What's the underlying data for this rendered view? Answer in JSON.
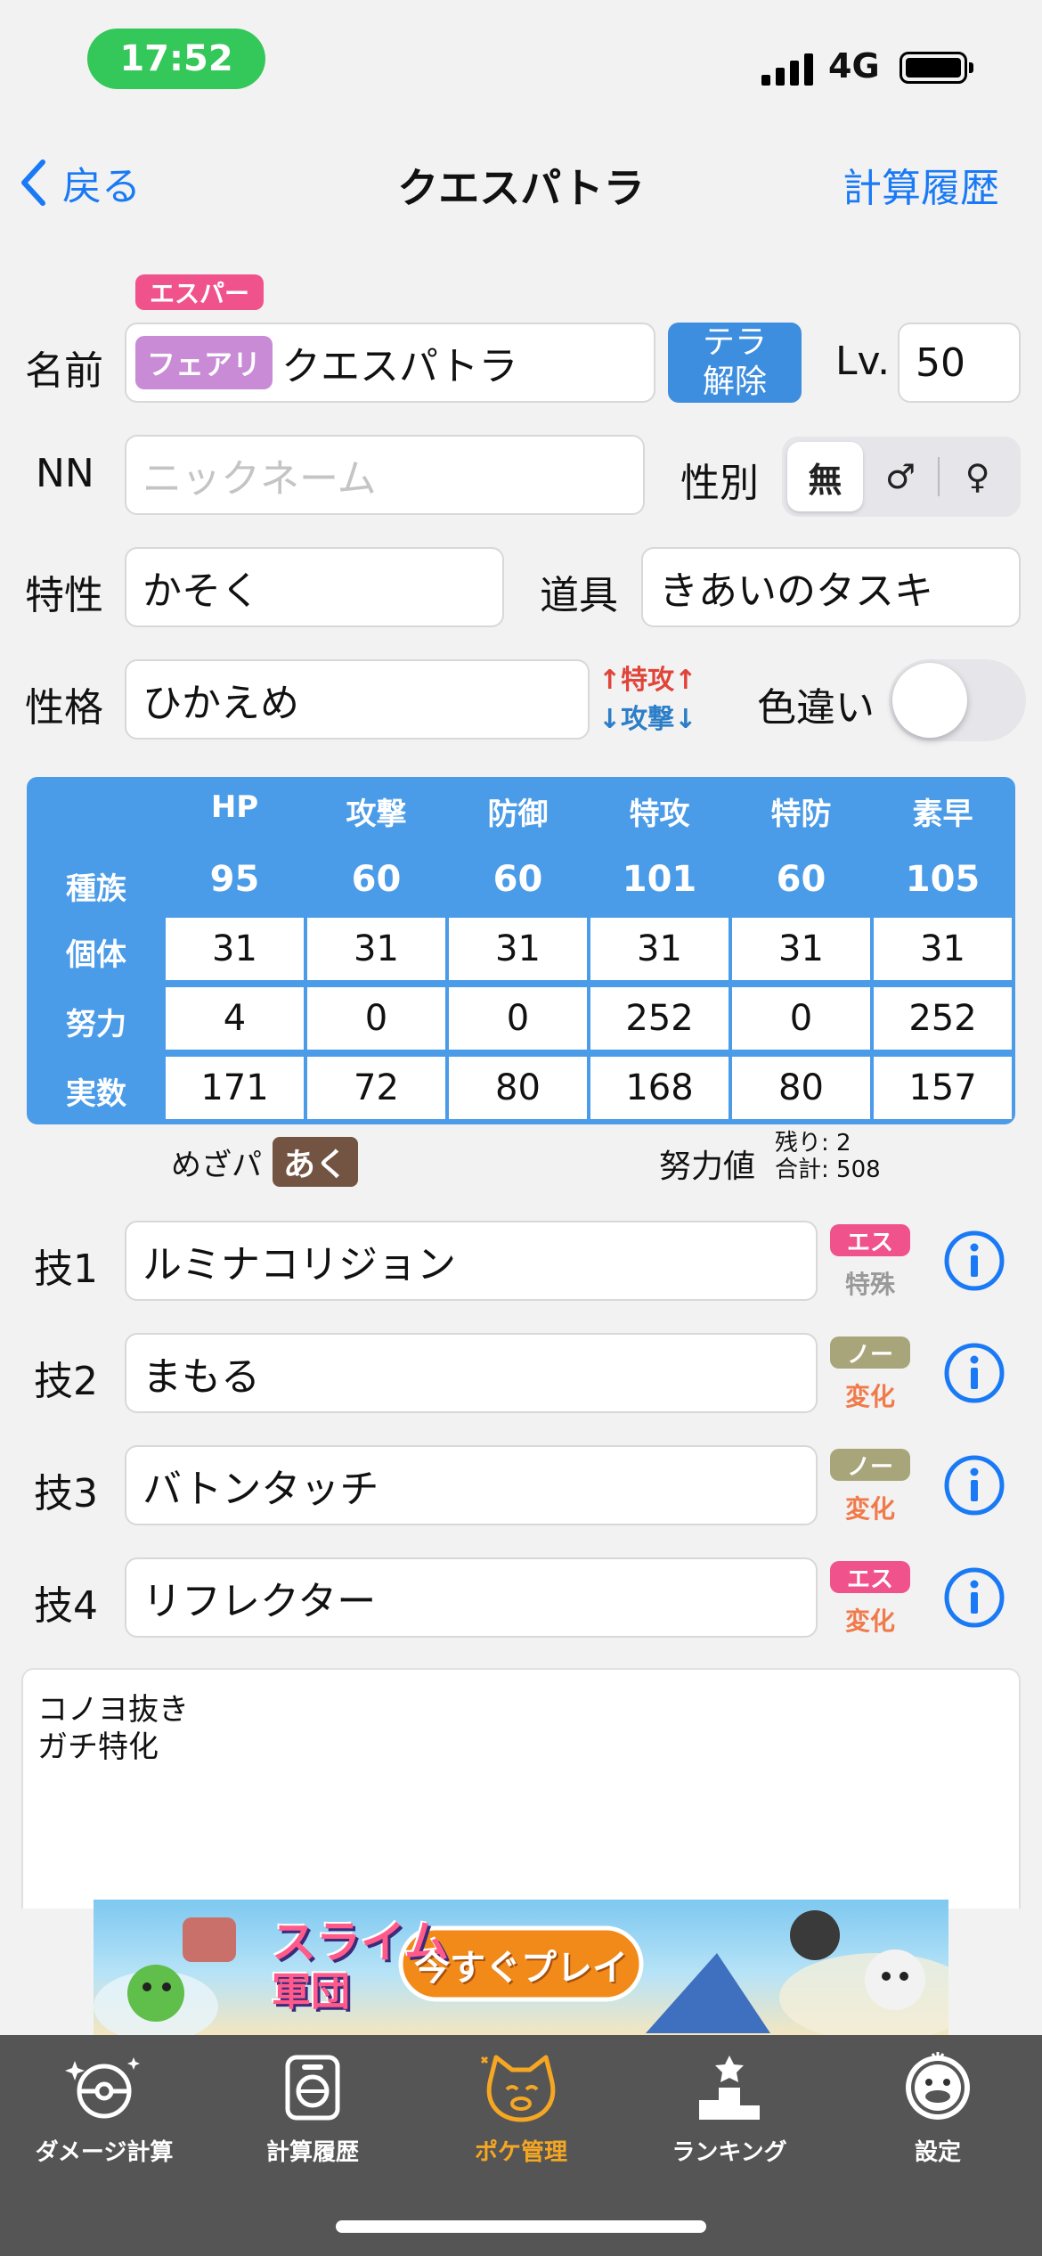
{
  "status_bar": {
    "time": "17:52",
    "network": "4G"
  },
  "nav": {
    "back_label": "戻る",
    "title": "クエスパトラ",
    "history_label": "計算履歴"
  },
  "form": {
    "type1": "エスパー",
    "type2": "フェアリ",
    "name_label": "名前",
    "name_value": "クエスパトラ",
    "tera_line1": "テラ",
    "tera_line2": "解除",
    "level_label": "Lv.",
    "level_value": "50",
    "nickname_label": "NN",
    "nickname_placeholder": "ニックネーム",
    "gender_label": "性別",
    "gender_options": [
      "無",
      "♂",
      "♀"
    ],
    "gender_selected": "無",
    "ability_label": "特性",
    "ability_value": "かそく",
    "item_label": "道具",
    "item_value": "きあいのタスキ",
    "nature_label": "性格",
    "nature_value": "ひかえめ",
    "nature_up": "↑特攻↑",
    "nature_down": "↓攻撃↓",
    "shiny_label": "色違い",
    "shiny_on": false
  },
  "stats": {
    "headers": [
      "HP",
      "攻撃",
      "防御",
      "特攻",
      "特防",
      "素早"
    ],
    "row_labels": [
      "種族",
      "個体",
      "努力",
      "実数"
    ],
    "base": [
      "95",
      "60",
      "60",
      "101",
      "60",
      "105"
    ],
    "iv": [
      "31",
      "31",
      "31",
      "31",
      "31",
      "31"
    ],
    "ev": [
      "4",
      "0",
      "0",
      "252",
      "0",
      "252"
    ],
    "actual": [
      "171",
      "72",
      "80",
      "168",
      "80",
      "157"
    ]
  },
  "hidden_power": {
    "label": "めざパ",
    "type": "あく"
  },
  "ev_summary": {
    "label": "努力値",
    "remaining": "残り: 2",
    "total": "合計: 508"
  },
  "moves": [
    {
      "label": "技1",
      "name": "ルミナコリジョン",
      "type": "エス",
      "category": "特殊"
    },
    {
      "label": "技2",
      "name": "まもる",
      "type": "ノー",
      "category": "変化"
    },
    {
      "label": "技3",
      "name": "バトンタッチ",
      "type": "ノー",
      "category": "変化"
    },
    {
      "label": "技4",
      "name": "リフレクター",
      "type": "エス",
      "category": "変化"
    }
  ],
  "memo": {
    "line1": "コノヨ抜き",
    "line2": "ガチ特化"
  },
  "ad": {
    "logo_line1": "スライム",
    "logo_line2": "軍団",
    "cta": "今すぐプレイ"
  },
  "tabs": [
    {
      "label": "ダメージ計算",
      "icon": "pokeball-sparkle-icon"
    },
    {
      "label": "計算履歴",
      "icon": "history-device-icon"
    },
    {
      "label": "ポケ管理",
      "icon": "cat-face-icon",
      "active": true
    },
    {
      "label": "ランキング",
      "icon": "podium-icon"
    },
    {
      "label": "設定",
      "icon": "psyduck-face-icon"
    }
  ],
  "colors": {
    "accent": "#1a7af5",
    "psychic": "#f0528c",
    "fairy": "#c98bd6",
    "normal": "#a8a57a",
    "dark": "#735442",
    "stats_bg": "#4a9be8",
    "tab_active": "#f5a623"
  }
}
